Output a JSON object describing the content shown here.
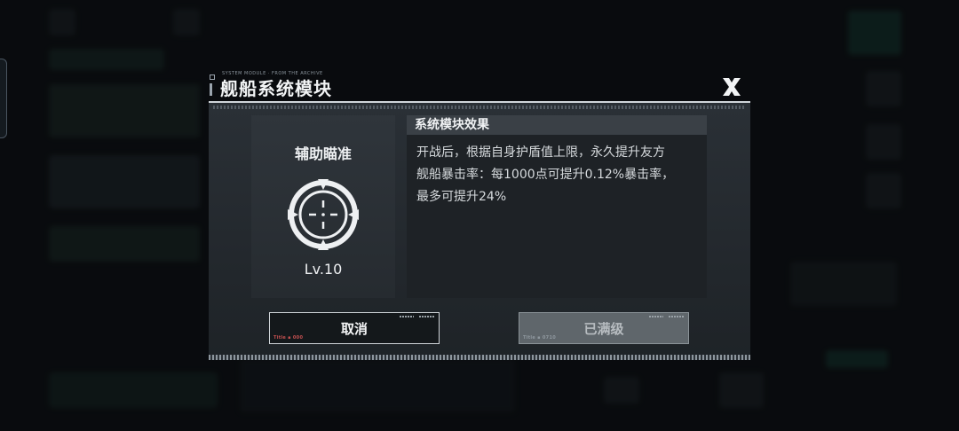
{
  "dialog": {
    "title": "舰船系统模块",
    "title_small_text": "SYSTEM MODULE · FROM THE ARCHIVE",
    "close_icon": "close-x-icon"
  },
  "module": {
    "name": "辅助瞄准",
    "icon": "crosshair-target-icon",
    "level": "Lv.10"
  },
  "effect": {
    "header": "系统模块效果",
    "lines": [
      "开战后，根据自身护盾值上限，永久提升友方",
      "舰船暴击率：每1000点可提升0.12%暴击率，",
      "最多可提升24%"
    ]
  },
  "buttons": {
    "cancel_label": "取消",
    "max_label": "已满级",
    "cancel_tag": "Title ▪ 000",
    "max_tag": "Title ▪ 0710"
  },
  "colors": {
    "panel_bg": "#23282d",
    "accent_white": "#cfd5da",
    "button_disabled": "#5f666b"
  }
}
